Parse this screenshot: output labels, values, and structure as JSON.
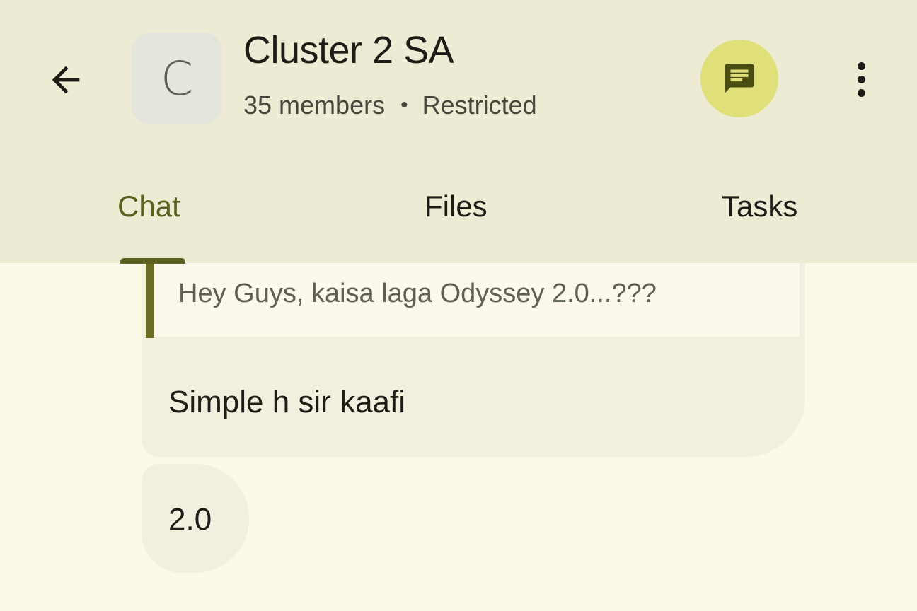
{
  "header": {
    "back_icon": "arrow-back-icon",
    "avatar_letter": "C",
    "title": "Cluster 2 SA",
    "members": "35 members",
    "separator": "•",
    "access": "Restricted",
    "thread_icon": "chat-threads-icon",
    "more_icon": "more-vert-icon"
  },
  "tabs": [
    {
      "label": "Chat",
      "active": true
    },
    {
      "label": "Files",
      "active": false
    },
    {
      "label": "Tasks",
      "active": false
    }
  ],
  "messages": [
    {
      "quoted_text": "Hey Guys, kaisa laga Odyssey 2.0...???",
      "text": "Simple h sir kaafi"
    },
    {
      "text": "2.0"
    }
  ],
  "colors": {
    "appbar_bg": "#edebd4",
    "page_bg": "#fcf9e8",
    "accent": "#5c6120",
    "thread_button": "#dfe07a",
    "bubble": "#f2efdf"
  }
}
